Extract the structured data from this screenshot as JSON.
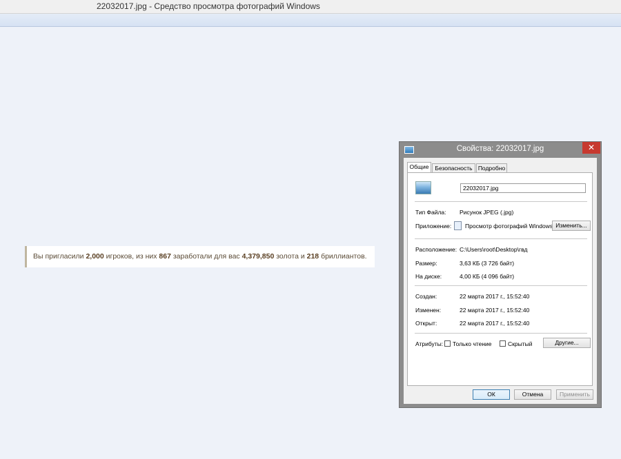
{
  "window": {
    "title": "22032017.jpg - Средство просмотра фотографий Windows"
  },
  "notice": {
    "prefix": "Вы пригласили ",
    "players": "2,000",
    "mid1": " игроков, из них ",
    "earners": "867",
    "mid2": " заработали для вас ",
    "gold": "4,379,850",
    "mid3": " золота и ",
    "diamonds": "218",
    "suffix": " бриллиантов."
  },
  "dialog": {
    "title": "Свойства: 22032017.jpg",
    "close": "✕",
    "tabs": [
      "Общие",
      "Безопасность",
      "Подробно"
    ],
    "active_tab": "Общие",
    "filename": "22032017.jpg",
    "file_type_label": "Тип Файла:",
    "file_type_value": "Рисунок JPEG (.jpg)",
    "app_label": "Приложение:",
    "app_value": "Просмотр фотографий Windows",
    "change_button": "Изменить...",
    "location_label": "Расположение:",
    "location_value": "C:\\Users\\root\\Desktop\\гвд",
    "size_label": "Размер:",
    "size_value": "3,63 КБ (3 726 байт)",
    "disk_label": "На диске:",
    "disk_value": "4,00 КБ (4 096 байт)",
    "created_label": "Создан:",
    "created_value": "22 марта 2017 г., 15:52:40",
    "modified_label": "Изменен:",
    "modified_value": "22 марта 2017 г., 15:52:40",
    "opened_label": "Открыт:",
    "opened_value": "22 марта 2017 г., 15:52:40",
    "attributes_label": "Атрибуты:",
    "readonly_label": "Только чтение",
    "hidden_label": "Скрытый",
    "other_button": "Другие...",
    "ok_button": "ОК",
    "cancel_button": "Отмена",
    "apply_button": "Применить"
  },
  "icons": {
    "file": "image-file-icon",
    "app": "photo-viewer-icon",
    "dialog": "image-icon"
  }
}
